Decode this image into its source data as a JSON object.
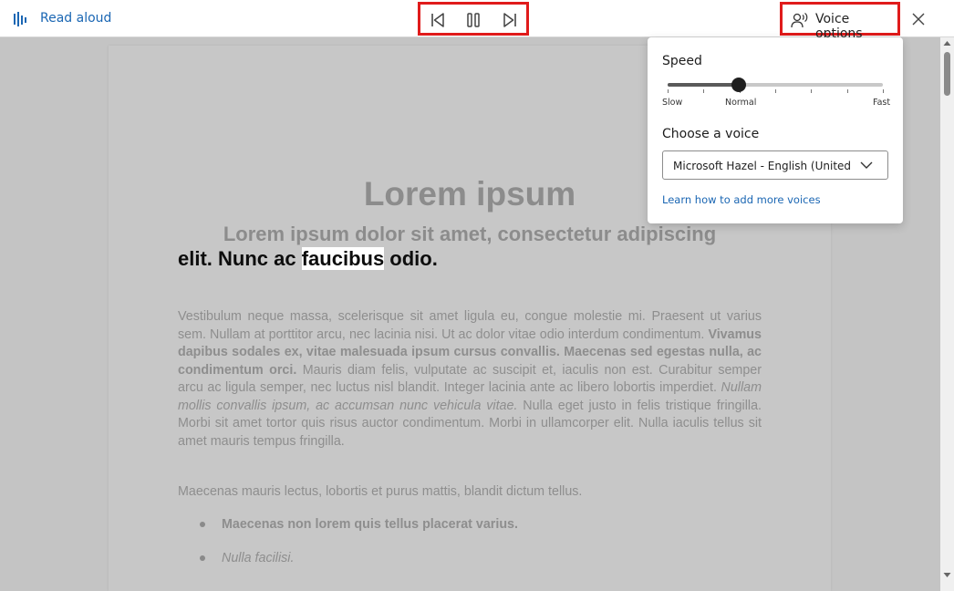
{
  "toolbar": {
    "read_aloud_label": "Read aloud",
    "read_aloud_icon": "read-aloud-icon",
    "prev_icon": "skip-previous-icon",
    "pause_icon": "pause-icon",
    "next_icon": "skip-next-icon",
    "voice_options_label": "Voice options",
    "voice_options_icon": "speaking-person-icon",
    "close_icon": "close-icon"
  },
  "document": {
    "title": "Lorem ipsum",
    "heading_line1": "Lorem ipsum dolor sit amet, consectetur adipiscing",
    "heading_line2_before": "elit. Nunc ac ",
    "heading_highlight": "faucibus",
    "heading_line2_after": " odio.",
    "para1": {
      "part1": "Vestibulum neque massa, scelerisque sit amet ligula eu, congue molestie mi. Praesent ut varius sem. Nullam at porttitor arcu, nec lacinia nisi. Ut ac dolor vitae odio interdum condimentum. ",
      "bold": "Vivamus dapibus sodales ex, vitae malesuada ipsum cursus convallis. Maecenas sed egestas nulla, ac condimentum orci.",
      "part2": " Mauris diam felis, vulputate ac suscipit et, iaculis non est. Curabitur semper arcu ac ligula semper, nec luctus nisl blandit. Integer lacinia ante ac libero lobortis imperdiet. ",
      "italic": "Nullam mollis convallis ipsum, ac accumsan nunc vehicula vitae.",
      "part3": " Nulla eget justo in felis tristique fringilla. Morbi sit amet tortor quis risus auctor condimentum. Morbi in ullamcorper elit. Nulla iaculis tellus sit amet mauris tempus fringilla."
    },
    "para2": "Maecenas mauris lectus, lobortis et purus mattis, blandit dictum tellus.",
    "list": [
      {
        "text": "Maecenas non lorem quis tellus placerat varius.",
        "style": "bold"
      },
      {
        "text": "Nulla facilisi.",
        "style": "italic"
      }
    ]
  },
  "voice_panel": {
    "speed_label": "Speed",
    "speed_min_label": "Slow",
    "speed_mid_label": "Normal",
    "speed_max_label": "Fast",
    "speed_value": 0.33,
    "speed_ticks": 7,
    "choose_voice_label": "Choose a voice",
    "selected_voice": "Microsoft Hazel - English (United Kin",
    "learn_link": "Learn how to add more voices"
  },
  "colors": {
    "accent": "#1a66b3",
    "highlight_box": "#e01b1b",
    "dim_overlay": "#c4c4c4"
  }
}
